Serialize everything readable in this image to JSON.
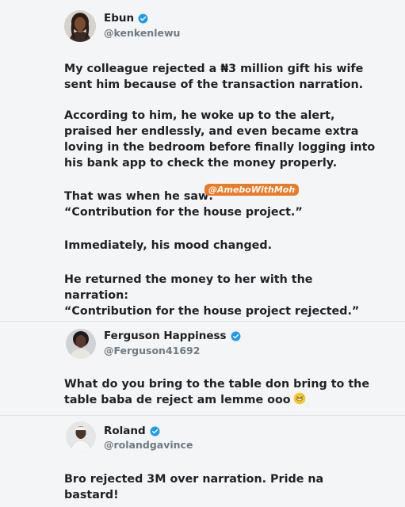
{
  "post1": {
    "name": "Ebun",
    "handle": "@kenkenlewu",
    "verified_color": "#1d9bf0",
    "paragraphs": [
      [
        "My colleague rejected a ₦3 million gift his wife",
        "sent him because of the transaction narration."
      ],
      [
        "According to him, he woke up to the alert,",
        "praised her endlessly, and even became extra",
        "loving in the bedroom before finally logging into",
        "his bank app to check the money properly."
      ],
      [
        "That was when he saw:",
        "“Contribution for the house project.”"
      ],
      [
        "Immediately, his mood changed."
      ],
      [
        "He returned the money to her with the",
        "narration:",
        "“Contribution for the house project rejected.”"
      ]
    ]
  },
  "watermark": "@AmeboWithMoh",
  "post2": {
    "name": "Ferguson Happiness",
    "handle": "@Ferguson41692",
    "lines": [
      "What do you bring to the table don bring to the",
      "table baba de reject am lemme ooo"
    ],
    "emoji": "grinning-sweat-emoji"
  },
  "post3": {
    "name": "Roland",
    "handle": "@rolandgavince",
    "lines": [
      "Bro rejected 3M over narration. Pride na",
      "bastard!"
    ]
  },
  "colors": {
    "background": "#f4f5f6",
    "text": "#1d2227",
    "handle": "#707a84",
    "verified": "#1d9bf0",
    "watermark": "#ea7b27"
  }
}
